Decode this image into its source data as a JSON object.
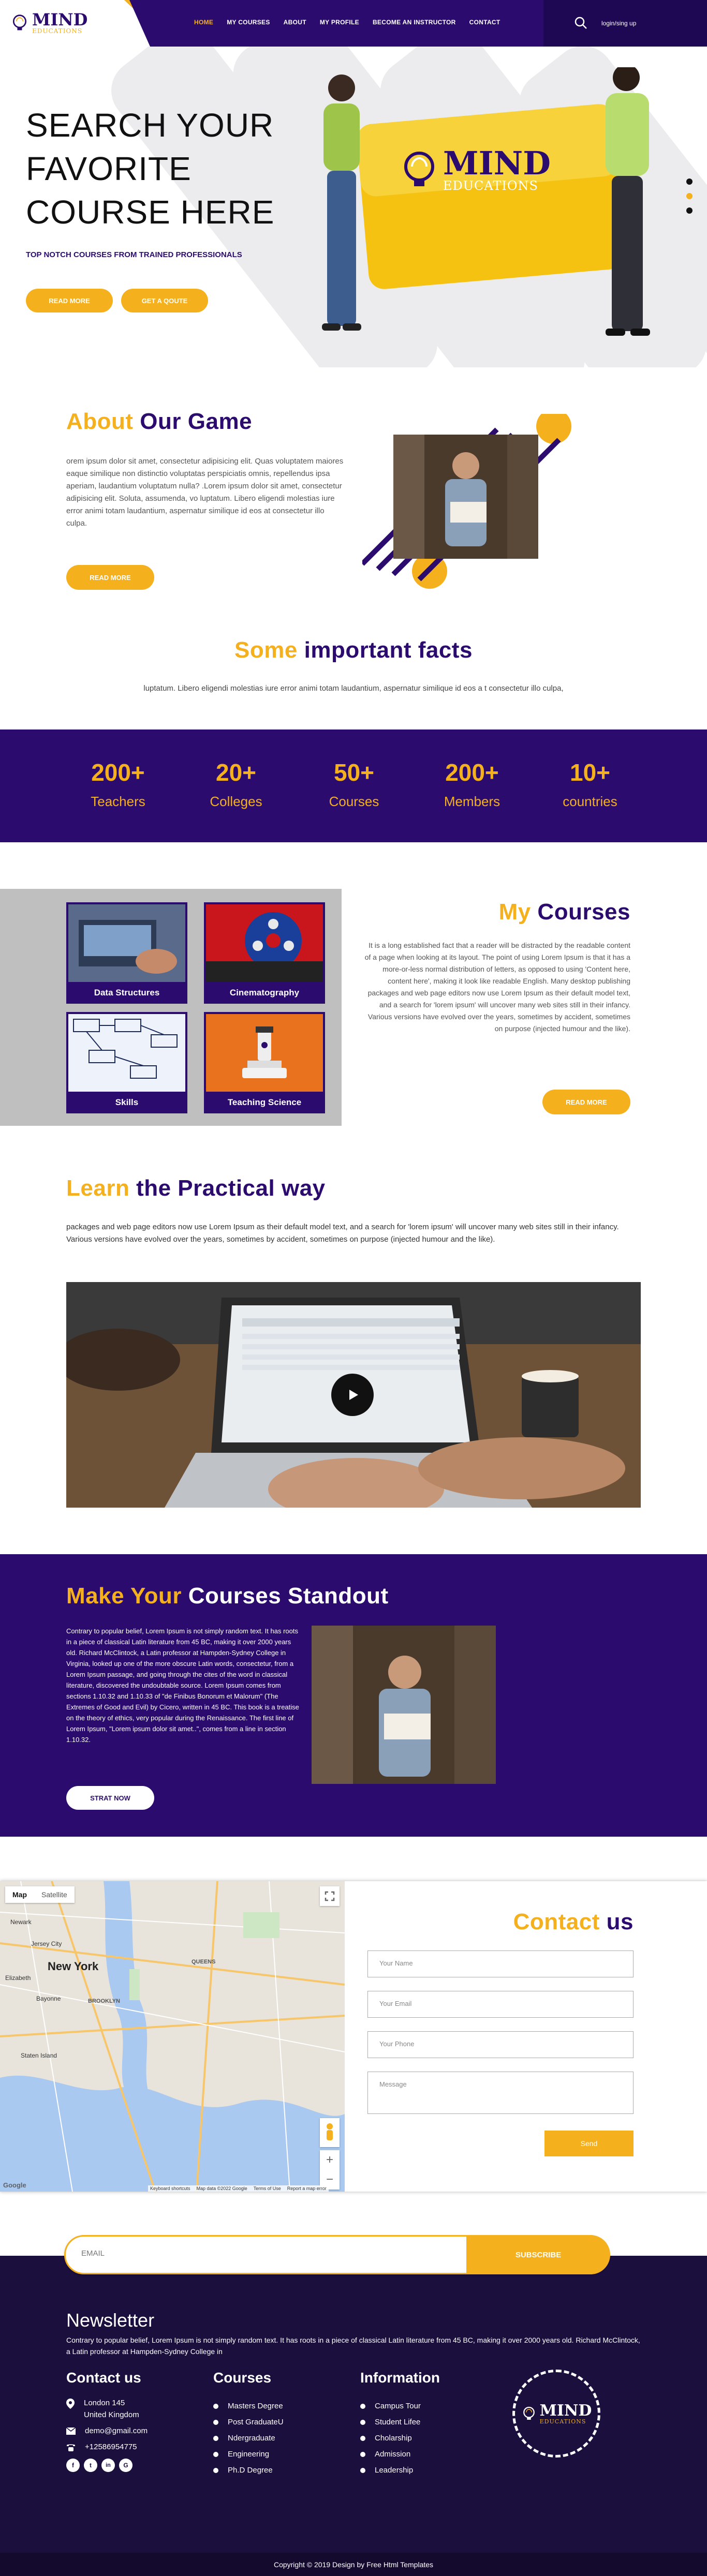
{
  "brand": {
    "name": "MIND",
    "sub": "EDUCATIONS"
  },
  "nav": {
    "items": [
      "HOME",
      "MY COURSES",
      "ABOUT",
      "MY PROFILE",
      "BECOME AN INSTRUCTOR",
      "CONTACT"
    ],
    "login": "login/sing up"
  },
  "hero": {
    "title_lines": [
      "SEARCH YOUR",
      "FAVORITE",
      "COURSE HERE"
    ],
    "subtitle": "TOP NOTCH COURSES FROM TRAINED PROFESSIONALS",
    "btn_read": "READ MORE",
    "btn_quote": "GET A QOUTE",
    "slide_dots": 3,
    "active_slide": 1
  },
  "about": {
    "title_a": "About",
    "title_b": "Our Game",
    "text": "orem ipsum dolor sit amet, consectetur adipisicing elit. Quas voluptatem maiores eaque similique non distinctio voluptatas perspiciatis omnis, repellendus ipsa aperiam, laudantium voluptatum nulla? .Lorem ipsum dolor sit amet, consectetur adipisicing elit. Soluta, assumenda, vo luptatum. Libero eligendi molestias iure error animi totam laudantium, aspernatur similique id eos at consectetur illo culpa.",
    "btn": "READ MORE"
  },
  "facts": {
    "title_a": "Some",
    "title_b": "important facts",
    "text": "luptatum. Libero eligendi molestias iure error animi totam laudantium, aspernatur similique id eos a t consectetur illo culpa,",
    "stats": [
      {
        "n": "200+",
        "l": "Teachers"
      },
      {
        "n": "20+",
        "l": "Colleges"
      },
      {
        "n": "50+",
        "l": "Courses"
      },
      {
        "n": "200+",
        "l": "Members"
      },
      {
        "n": "10+",
        "l": "countries"
      }
    ]
  },
  "courses": {
    "title_a": "My",
    "title_b": "Courses",
    "cards": [
      "Data Structures",
      "Cinematography",
      "Skills",
      "Teaching Science"
    ],
    "text": "It is a long established fact that a reader will be distracted by the readable content of a page when looking at its layout. The point of using Lorem Ipsum is that it has a more-or-less normal distribution of letters, as opposed to using 'Content here, content here', making it look like readable English. Many desktop publishing packages and web page editors now use Lorem Ipsum as their default model text, and a search for 'lorem ipsum' will uncover many web sites still in their infancy. Various versions have evolved over the years, sometimes by accident, sometimes on purpose (injected humour and the like).",
    "btn": "READ MORE"
  },
  "learn": {
    "title_a": "Learn",
    "title_b": "the Practical way",
    "text": "packages and web page editors now use Lorem Ipsum as their default model text, and a search for 'lorem ipsum' will uncover many web sites still in their infancy. Various versions have evolved over the years, sometimes by accident, sometimes on purpose (injected humour and the like)."
  },
  "standout": {
    "title_a": "Make Your",
    "title_b": "Courses Standout",
    "text": "Contrary to popular belief, Lorem Ipsum is not simply random text. It has roots in a piece of classical Latin literature from 45 BC, making it over 2000 years old. Richard McClintock, a Latin professor at Hampden-Sydney College in Virginia, looked up one of the more obscure Latin words, consectetur, from a Lorem Ipsum passage, and going through the cites of the word in classical literature, discovered the undoubtable source. Lorem Ipsum comes from sections 1.10.32 and 1.10.33 of \"de Finibus Bonorum et Malorum\" (The Extremes of Good and Evil) by Cicero, written in 45 BC. This book is a treatise on the theory of ethics, very popular during the Renaissance. The first line of Lorem Ipsum, \"Lorem ipsum dolor sit amet..\", comes from a line in section 1.10.32.",
    "btn": "STRAT NOW"
  },
  "map": {
    "tab_map": "Map",
    "tab_sat": "Satellite",
    "city": "New York",
    "labels": [
      "BROOKLYN",
      "QUEENS",
      "Jersey City",
      "Newark",
      "Elizabeth",
      "Staten Island",
      "Bayonne"
    ],
    "footer": [
      "Keyboard shortcuts",
      "Map data ©2022 Google",
      "Terms of Use",
      "Report a map error"
    ],
    "google": "Google"
  },
  "contact": {
    "title_a": "Contact",
    "title_b": "us",
    "name": "Your Name",
    "email": "Your Email",
    "phone": "Your Phone",
    "message": "Message",
    "btn": "Send"
  },
  "subscribe": {
    "placeholder": "EMAIL",
    "btn": "SUBSCRIBE"
  },
  "footer": {
    "newsletter": "Newsletter",
    "news_text": "Contrary to popular belief, Lorem Ipsum is not simply random text. It has roots in a piece of classical Latin literature from 45 BC, making it over 2000 years old. Richard McClintock, a Latin professor at Hampden-Sydney College in",
    "contact_h": "Contact us",
    "addr1": "London 145",
    "addr2": "United Kingdom",
    "mail": "demo@gmail.com",
    "phone": "+12586954775",
    "courses_h": "Courses",
    "courses": [
      "Masters Degree",
      "Post GraduateU",
      "Ndergraduate",
      "Engineering",
      "Ph.D Degree"
    ],
    "info_h": "Information",
    "info": [
      "Campus Tour",
      "Student Lifee",
      "Cholarship",
      "Admission",
      "Leadership"
    ],
    "social": [
      "f",
      "t",
      "in",
      "G"
    ]
  },
  "copyright": "Copyright © 2019 Design by Free Html Templates",
  "colors": {
    "purple": "#2b0c6e",
    "yellow": "#f5b01d"
  },
  "icons": {
    "search": "search-icon",
    "play": "play-icon",
    "pin": "map-pin-icon",
    "mail": "mail-icon",
    "phone": "phone-icon"
  }
}
